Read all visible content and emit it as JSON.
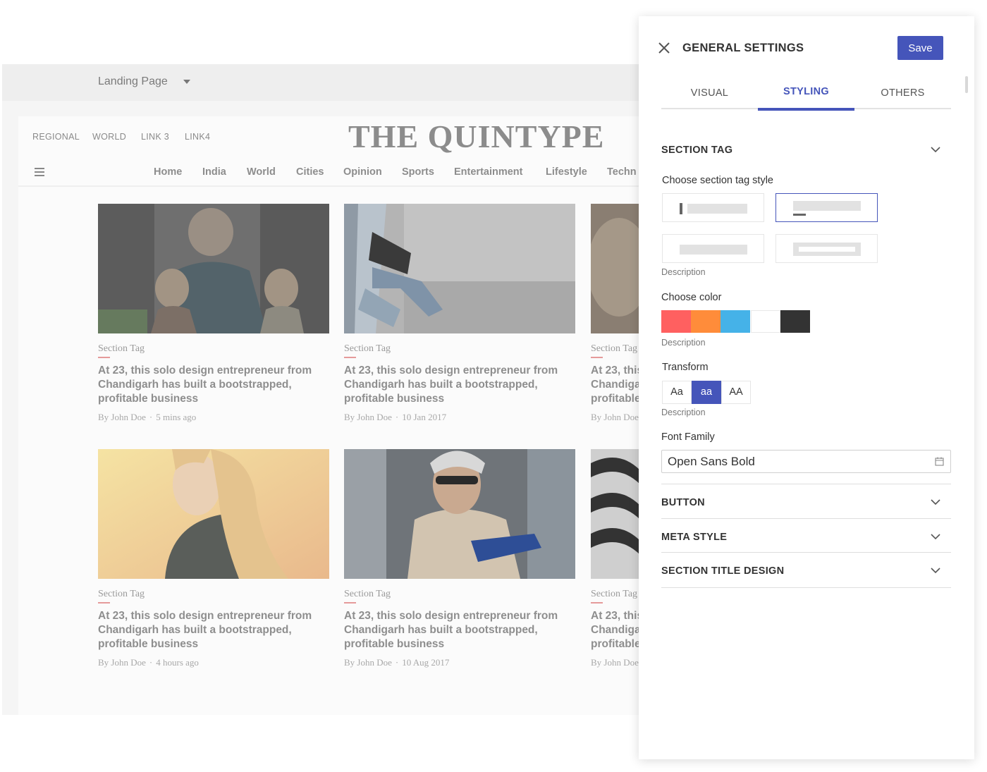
{
  "editor": {
    "page_selector": {
      "label": "Landing Page",
      "icon": "caret-down-icon"
    }
  },
  "site": {
    "top_links": [
      "REGIONAL",
      "WORLD",
      "LINK 3",
      "LINK4"
    ],
    "logo": "THE QUINTYPE",
    "menu_icon": "hamburger-icon",
    "nav": [
      "Home",
      "India",
      "World",
      "Cities",
      "Opinion",
      "Sports",
      "Entertainment",
      "Lifestyle",
      "Techn"
    ],
    "cards": [
      {
        "tag": "Section Tag",
        "headline": "At 23, this solo design entrepreneur from Chandigarh has built a bootstrapped, profitable business",
        "by": "By",
        "author": "John Doe",
        "sep": "·",
        "time": "5 mins ago"
      },
      {
        "tag": "Section Tag",
        "headline": "At 23, this solo design entrepreneur from Chandigarh has built a bootstrapped, profitable business",
        "by": "By",
        "author": "John Doe",
        "sep": "·",
        "time": "10 Jan 2017"
      },
      {
        "tag": "Section Tag",
        "headline": "At 23, this Chandiga profitable",
        "by": "By",
        "author": "John Doe",
        "sep": "",
        "time": ""
      },
      {
        "tag": "Section Tag",
        "headline": "At 23, this solo design entrepreneur from Chandigarh has built a bootstrapped, profitable business",
        "by": "By",
        "author": "John Doe",
        "sep": "·",
        "time": "4 hours ago"
      },
      {
        "tag": "Section Tag",
        "headline": "At 23, this solo design entrepreneur from Chandigarh has built a bootstrapped, profitable business",
        "by": "By",
        "author": "John Doe",
        "sep": "·",
        "time": "10 Aug 2017"
      },
      {
        "tag": "Section Tag",
        "headline": "At 23, this Chandiga profitable",
        "by": "By",
        "author": "John Doe",
        "sep": "",
        "time": ""
      }
    ]
  },
  "panel": {
    "title": "GENERAL SETTINGS",
    "save_label": "Save",
    "tabs": [
      {
        "label": "VISUAL",
        "active": false
      },
      {
        "label": "STYLING",
        "active": true
      },
      {
        "label": "OTHERS",
        "active": false
      }
    ],
    "section_tag": {
      "heading": "SECTION TAG",
      "style_label": "Choose section tag style",
      "style_description": "Description",
      "color_label": "Choose color",
      "colors": [
        "#ff6060",
        "#ff8c3a",
        "#45b2e8",
        "#ffffff",
        "#333333"
      ],
      "color_description": "Description",
      "transform_label": "Transform",
      "transform_options": [
        "Aa",
        "aa",
        "AA"
      ],
      "transform_selected": "aa",
      "transform_description": "Description",
      "font_family_label": "Font Family",
      "font_family_value": "Open Sans Bold"
    },
    "sections": [
      "BUTTON",
      "META STYLE",
      "SECTION TITLE DESIGN"
    ],
    "accent": "#4555ba"
  }
}
